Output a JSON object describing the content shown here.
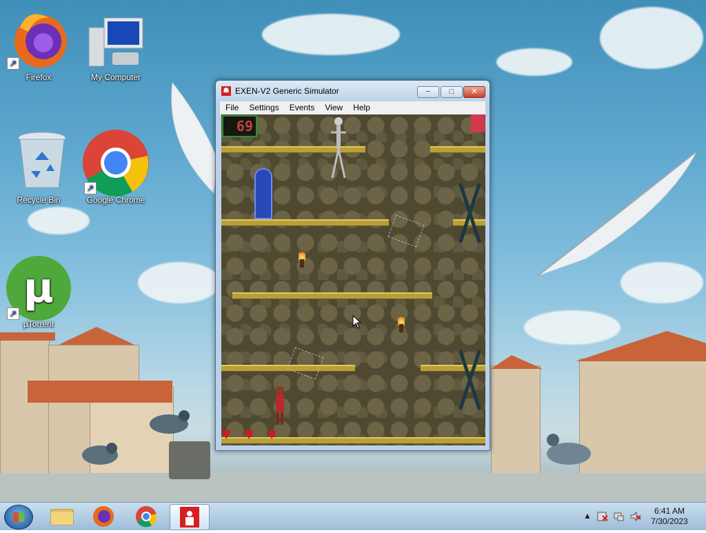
{
  "desktop": {
    "icons": [
      {
        "label": "Firefox"
      },
      {
        "label": "My Computer"
      },
      {
        "label": "Recycle Bin"
      },
      {
        "label": "Google Chrome"
      },
      {
        "label": "µTorrent"
      }
    ]
  },
  "window": {
    "title": "EXEN-V2 Generic Simulator",
    "controls": {
      "minimize": "−",
      "maximize": "□",
      "close": "✕"
    },
    "menu": [
      "File",
      "Settings",
      "Events",
      "View",
      "Help"
    ]
  },
  "game": {
    "score": "69",
    "lives": 3,
    "heart_glyph": "♥"
  },
  "taskbar": {
    "items": [
      "windows-explorer",
      "firefox",
      "google-chrome",
      "exen-simulator"
    ],
    "tray": {
      "show_hidden": "▲",
      "time": "6:41 AM",
      "date": "7/30/2023"
    }
  },
  "colors": {
    "accent": "#d62020",
    "score_text": "#c8413a",
    "score_border": "#2f8f2f",
    "platform": "#b99e3a",
    "heart": "#d21a1a"
  }
}
